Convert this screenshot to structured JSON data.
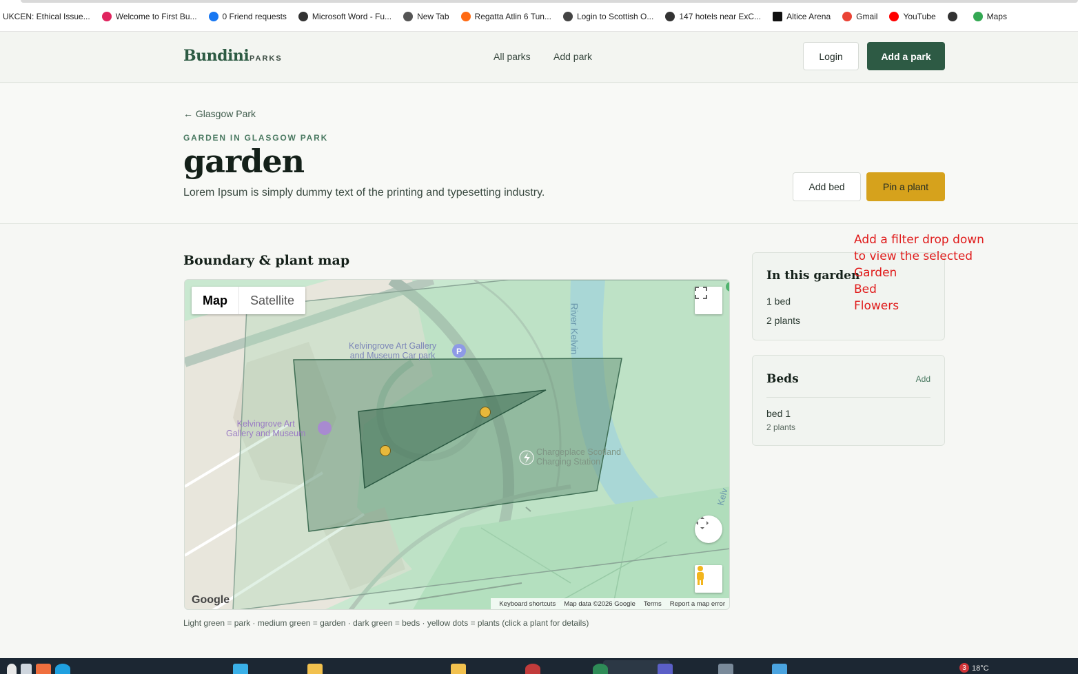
{
  "bookmarks": [
    {
      "label": "UKCEN: Ethical Issue...",
      "color": "#ffffff"
    },
    {
      "label": "Welcome to First Bu...",
      "color": "#e0245e"
    },
    {
      "label": "0 Friend requests",
      "color": "#1877f2"
    },
    {
      "label": "Microsoft Word - Fu...",
      "color": "#333333"
    },
    {
      "label": "New Tab",
      "color": "#555555"
    },
    {
      "label": "Regatta Atlin 6 Tun...",
      "color": "#ff6a13"
    },
    {
      "label": "Login to Scottish O...",
      "color": "#444444"
    },
    {
      "label": "147 hotels near ExC...",
      "color": "#333333"
    },
    {
      "label": "Altice Arena",
      "color": "#111111"
    },
    {
      "label": "Gmail",
      "color": "#ea4335"
    },
    {
      "label": "YouTube",
      "color": "#ff0000"
    },
    {
      "label": "",
      "color": "#333333"
    },
    {
      "label": "Maps",
      "color": "#34a853"
    }
  ],
  "header": {
    "logo": "Bundini",
    "logo_sub": "PARKS",
    "nav": {
      "all_parks": "All parks",
      "add_park": "Add park"
    },
    "login": "Login",
    "add_a_park": "Add a park"
  },
  "hero": {
    "back_link": "← Glasgow Park",
    "eyebrow": "GARDEN IN GLASGOW PARK",
    "title": "garden",
    "description": "Lorem Ipsum is simply dummy text of the printing and typesetting industry.",
    "add_bed": "Add bed",
    "pin_plant": "Pin a plant"
  },
  "map": {
    "section_title": "Boundary & plant map",
    "toggle_map": "Map",
    "toggle_satellite": "Satellite",
    "labels": {
      "car_park_1": "Kelvingrove Art Gallery",
      "car_park_2": "and Museum Car park",
      "museum_1": "Kelvingrove Art",
      "museum_2": "Gallery and Museum",
      "charge_1": "Chargeplace Scotland",
      "charge_2": "Charging Station",
      "river": "River Kelvin",
      "river2": "Kelv"
    },
    "google": "Google",
    "attribution": {
      "shortcuts": "Keyboard shortcuts",
      "data": "Map data ©2026 Google",
      "terms": "Terms",
      "report": "Report a map error"
    },
    "caption": "Light green = park · medium green = garden · dark green = beds · yellow dots = plants (click a plant for details)",
    "colors": {
      "park": "#a9d6b5",
      "garden": "#5e8a6e",
      "bed": "#3f6e54",
      "plant": "#e8b83b"
    }
  },
  "sidebar": {
    "in_garden": {
      "title": "In this garden",
      "beds": "1 bed",
      "plants": "2 plants"
    },
    "beds": {
      "title": "Beds",
      "add": "Add",
      "items": [
        {
          "name": "bed 1",
          "plants": "2 plants"
        }
      ]
    }
  },
  "annotation": "Add a filter drop down\nto view the selected\nGarden\nBed\nFlowers",
  "taskbar": {
    "badge": "3",
    "temp": "18°C"
  }
}
